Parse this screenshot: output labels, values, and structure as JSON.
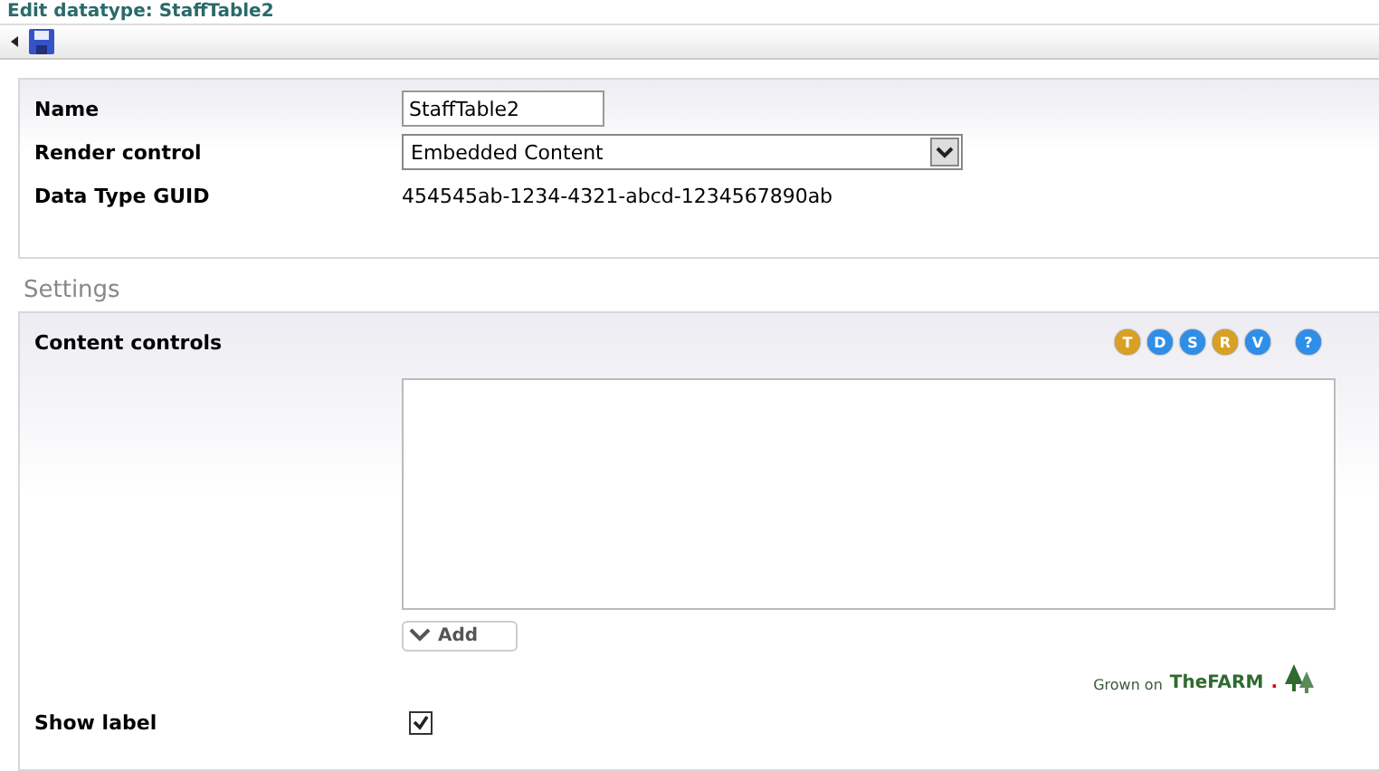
{
  "title": "Edit datatype: StaffTable2",
  "general": {
    "fields": [
      {
        "kind": "input",
        "label": "Name",
        "value": "StaffTable2"
      },
      {
        "kind": "select",
        "label": "Render control",
        "value": "Embedded Content"
      },
      {
        "kind": "text",
        "label": "Data Type GUID",
        "value": "454545ab-1234-4321-abcd-1234567890ab"
      }
    ]
  },
  "settings_heading": "Settings",
  "settings": {
    "content_label": "Content controls",
    "badges": [
      {
        "letter": "T",
        "color": "#d9a024"
      },
      {
        "letter": "D",
        "color": "#2f8fe8"
      },
      {
        "letter": "S",
        "color": "#2f8fe8"
      },
      {
        "letter": "R",
        "color": "#d9a024"
      },
      {
        "letter": "V",
        "color": "#2f8fe8"
      },
      {
        "letter": "?",
        "color": "#2f8fe8"
      }
    ],
    "add_button": "Add",
    "logo": {
      "prefix": "Grown on",
      "brand": "TheFARM",
      "dot": "."
    },
    "show_label": {
      "label": "Show label",
      "checked": true
    }
  }
}
